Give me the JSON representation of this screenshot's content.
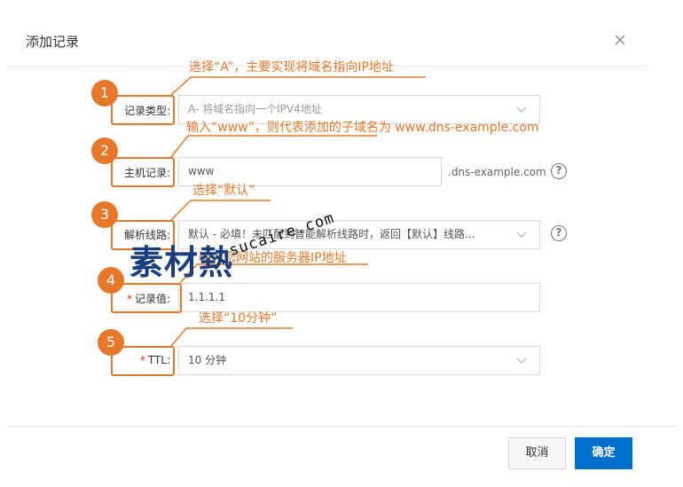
{
  "dialog": {
    "title": "添加记录"
  },
  "fields": {
    "record_type": {
      "label": "记录类型:",
      "value": "A- 将域名指向一个IPV4地址"
    },
    "host": {
      "label": "主机记录:",
      "value": "www",
      "suffix": ".dns-example.com"
    },
    "line": {
      "label": "解析线路:",
      "value": "默认 - 必填！未匹配到智能解析线路时，返回【默认】线路..."
    },
    "record_value": {
      "label": "记录值:",
      "value": "1.1.1.1"
    },
    "ttl": {
      "label": "TTL:",
      "value": "10 分钟"
    }
  },
  "annotations": [
    {
      "num": "1",
      "text": "选择“A”，主要实现将域名指向IP地址"
    },
    {
      "num": "2",
      "text": "输入“www”，则代表添加的子域名为 www.dns-example.com"
    },
    {
      "num": "3",
      "text": "选择“默认”"
    },
    {
      "num": "4",
      "text": "输入您网站的服务器IP地址"
    },
    {
      "num": "5",
      "text": "选择“10分钟”"
    }
  ],
  "watermark": {
    "brand": "素材熱",
    "site": "sucaire.com"
  },
  "buttons": {
    "cancel": "取消",
    "ok": "确定"
  },
  "colors": {
    "accent": "#e7782a",
    "primary": "#0070cc",
    "required": "#e2231a"
  }
}
